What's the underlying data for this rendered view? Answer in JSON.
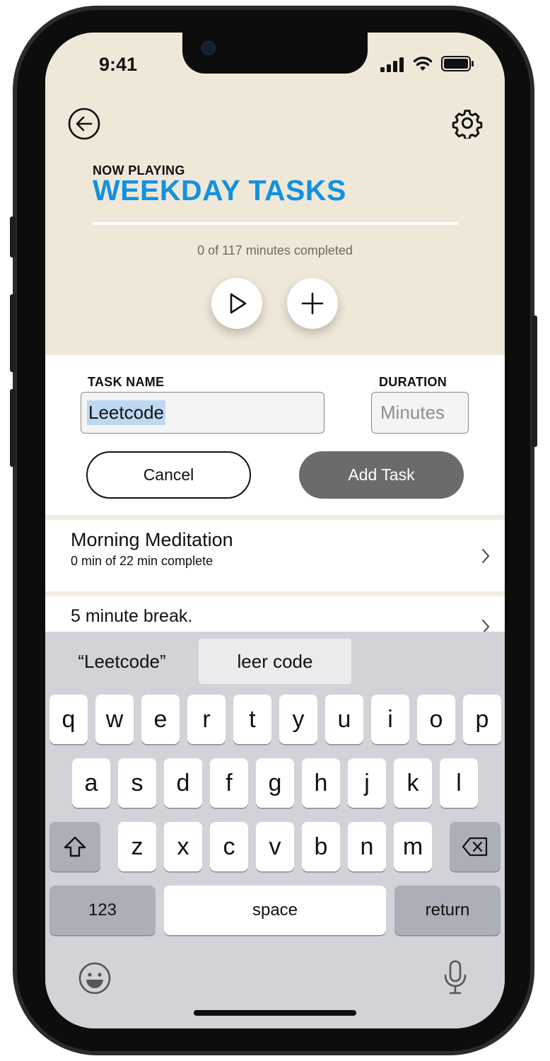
{
  "status_bar": {
    "time": "9:41"
  },
  "header": {
    "now_playing_label": "NOW PLAYING",
    "playlist_title": "WEEKDAY TASKS",
    "progress_text": "0 of 117 minutes completed",
    "progress_fraction": 0
  },
  "form": {
    "task_name_label": "TASK NAME",
    "task_name_value": "Leetcode",
    "duration_label": "DURATION",
    "duration_placeholder": "Minutes",
    "cancel_label": "Cancel",
    "add_label": "Add Task"
  },
  "tasks": [
    {
      "title": "Morning Meditation",
      "subtitle": "0 min of 22 min complete"
    },
    {
      "title": "5 minute break.",
      "subtitle": ""
    }
  ],
  "keyboard": {
    "suggestions": [
      "“Leetcode”",
      "leer code"
    ],
    "row1": [
      "q",
      "w",
      "e",
      "r",
      "t",
      "y",
      "u",
      "i",
      "o",
      "p"
    ],
    "row2": [
      "a",
      "s",
      "d",
      "f",
      "g",
      "h",
      "j",
      "k",
      "l"
    ],
    "row3": [
      "z",
      "x",
      "c",
      "v",
      "b",
      "n",
      "m"
    ],
    "numbers_label": "123",
    "space_label": "space",
    "return_label": "return"
  },
  "colors": {
    "accent": "#1391e0",
    "header_bg": "#efe8d9",
    "keyboard_bg": "#d1d3d9",
    "add_button_bg": "#6b6b6b"
  }
}
